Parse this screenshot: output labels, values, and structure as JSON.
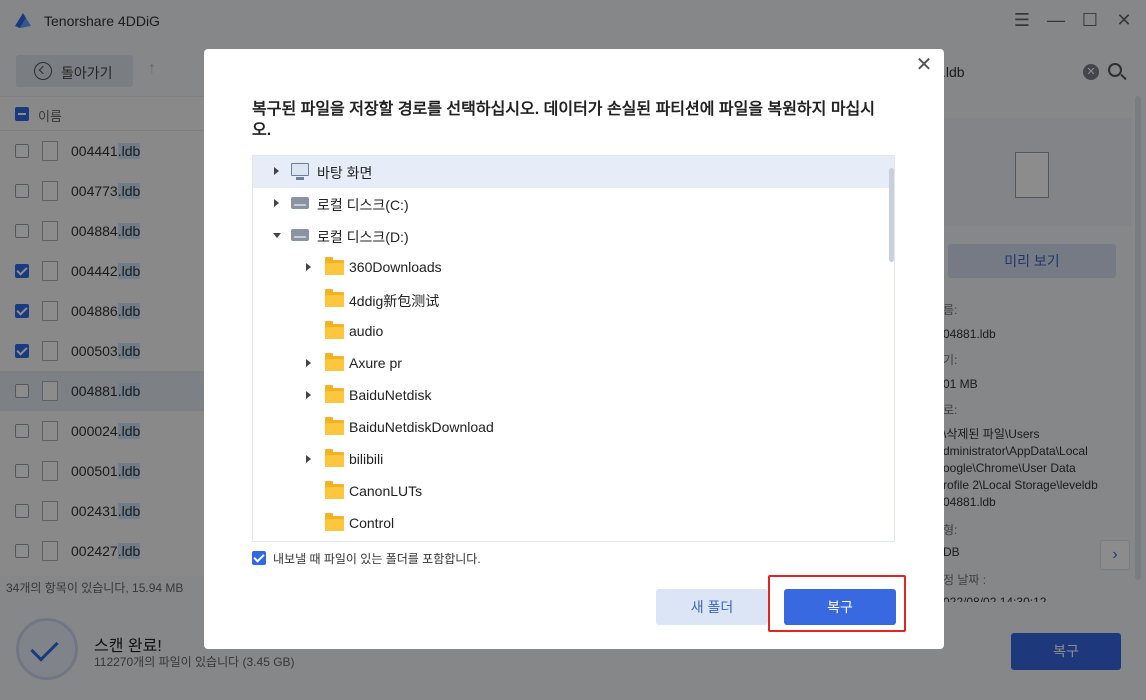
{
  "app": {
    "title": "Tenorshare 4DDiG",
    "toolbar": {
      "back_label": "돌아가기"
    },
    "search": {
      "value": ".ldb"
    },
    "file_list": {
      "header_label": "이름",
      "rows": [
        {
          "base": "004441",
          "ext": ".ldb",
          "checked": false,
          "selected": false
        },
        {
          "base": "004773",
          "ext": ".ldb",
          "checked": false,
          "selected": false
        },
        {
          "base": "004884",
          "ext": ".ldb",
          "checked": false,
          "selected": false
        },
        {
          "base": "004442",
          "ext": ".ldb",
          "checked": true,
          "selected": false
        },
        {
          "base": "004886",
          "ext": ".ldb",
          "checked": true,
          "selected": false
        },
        {
          "base": "000503",
          "ext": ".ldb",
          "checked": true,
          "selected": false
        },
        {
          "base": "004881",
          "ext": ".ldb",
          "checked": false,
          "selected": true
        },
        {
          "base": "000024",
          "ext": ".ldb",
          "checked": false,
          "selected": false
        },
        {
          "base": "000501",
          "ext": ".ldb",
          "checked": false,
          "selected": false
        },
        {
          "base": "002431",
          "ext": ".ldb",
          "checked": false,
          "selected": false
        },
        {
          "base": "002427",
          "ext": ".ldb",
          "checked": false,
          "selected": false
        }
      ],
      "footer": "34개의 항목이 있습니다, 15.94 MB"
    },
    "preview": {
      "button_label": "미리 보기",
      "name_label": "름:",
      "name_value": "04881.ldb",
      "size_label": "기:",
      "size_value": "01 MB",
      "path_label": "로:",
      "path_value": "\\삭제된 파일\\Users\ndministrator\\AppData\\Local\noogle\\Chrome\\User Data\nrofile 2\\Local Storage\\leveldb\n04881.ldb",
      "type_label": "형:",
      "type_value": "DB",
      "date_label": "정 날짜 :",
      "date_value": "022/08/02 14:30:12"
    },
    "status": {
      "title": "스캔 완료!",
      "subtitle": "112270개의 파일이 있습니다 (3.45 GB)",
      "recover_label": "복구"
    }
  },
  "dialog": {
    "message": "복구된 파일을 저장할 경로를 선택하십시오. 데이터가 손실된 파티션에 파일을 복원하지 마십시오.",
    "tree": [
      {
        "label": "바탕 화면",
        "icon": "monitor-icon",
        "level": 0,
        "expand": "collapsed",
        "selected": true
      },
      {
        "label": "로컬 디스크(C:)",
        "icon": "disk-icon",
        "level": 0,
        "expand": "collapsed",
        "selected": false
      },
      {
        "label": "로컬 디스크(D:)",
        "icon": "disk-icon",
        "level": 0,
        "expand": "expanded",
        "selected": false
      },
      {
        "label": "360Downloads",
        "icon": "folder-icon",
        "level": 1,
        "expand": "collapsed",
        "selected": false
      },
      {
        "label": "4ddig新包测试",
        "icon": "folder-icon",
        "level": 1,
        "expand": "none",
        "selected": false
      },
      {
        "label": "audio",
        "icon": "folder-icon",
        "level": 1,
        "expand": "none",
        "selected": false
      },
      {
        "label": "Axure pr",
        "icon": "folder-icon",
        "level": 1,
        "expand": "collapsed",
        "selected": false
      },
      {
        "label": "BaiduNetdisk",
        "icon": "folder-icon",
        "level": 1,
        "expand": "collapsed",
        "selected": false
      },
      {
        "label": "BaiduNetdiskDownload",
        "icon": "folder-icon",
        "level": 1,
        "expand": "none",
        "selected": false
      },
      {
        "label": "bilibili",
        "icon": "folder-icon",
        "level": 1,
        "expand": "collapsed",
        "selected": false
      },
      {
        "label": "CanonLUTs",
        "icon": "folder-icon",
        "level": 1,
        "expand": "none",
        "selected": false
      },
      {
        "label": "Control",
        "icon": "folder-icon",
        "level": 1,
        "expand": "none",
        "selected": false
      }
    ],
    "include_folders": {
      "label": "내보낼 때 파일이 있는 폴더를 포함합니다.",
      "checked": true
    },
    "new_folder_label": "새 폴더",
    "recover_label": "복구"
  },
  "colors": {
    "accent": "#3869e0",
    "highlight": "#e52420",
    "folder": "#ffc53d"
  }
}
